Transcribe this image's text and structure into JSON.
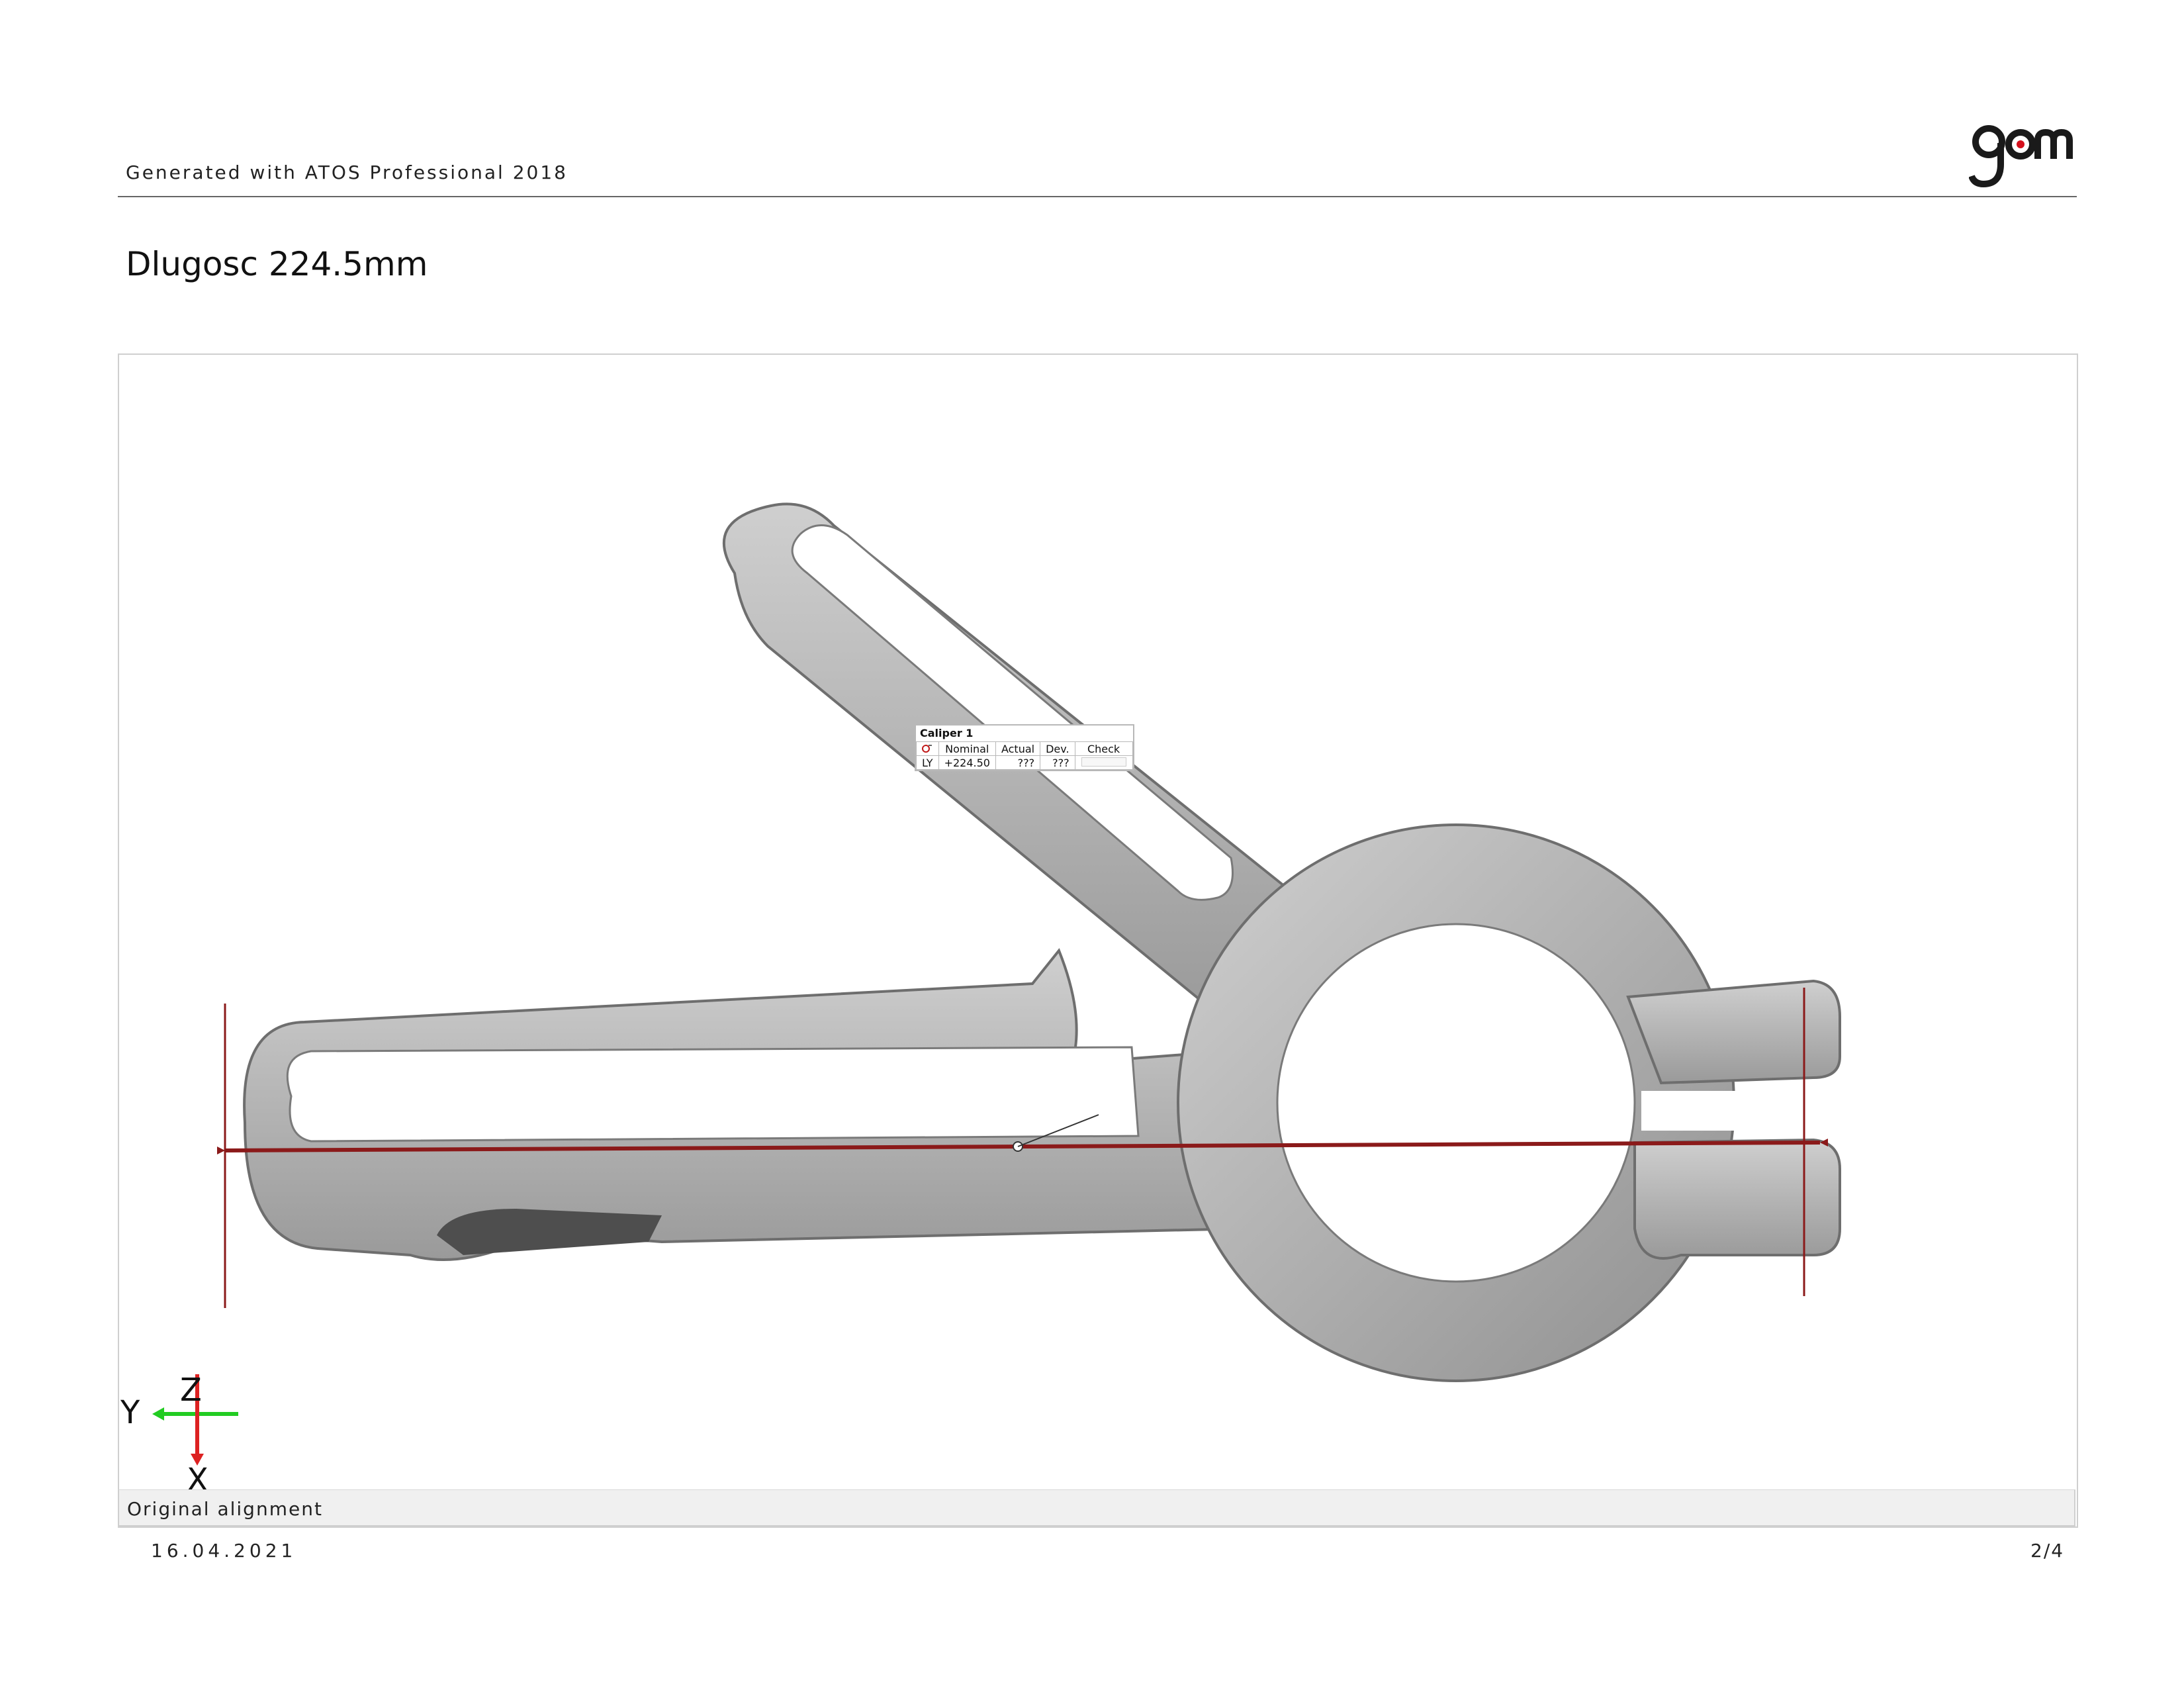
{
  "header": {
    "generated_text": "Generated with ATOS Professional 2018",
    "logo_text": "gom"
  },
  "title": "Dlugosc 224.5mm",
  "caliper": {
    "name": "Caliper 1",
    "columns": [
      "Nominal",
      "Actual",
      "Dev.",
      "Check"
    ],
    "row": {
      "axis": "LY",
      "nominal": "+224.50",
      "actual": "???",
      "dev": "???",
      "check": ""
    }
  },
  "axes": {
    "y": "Y",
    "z": "Z",
    "x": "X"
  },
  "caption": "Original alignment",
  "footer": {
    "date": "16.04.2021",
    "page": "2/4"
  },
  "colors": {
    "part": "#b9b9b9",
    "caliper_line": "#8b1a1a",
    "y_axis": "#22cc22",
    "x_axis": "#dd2222"
  }
}
